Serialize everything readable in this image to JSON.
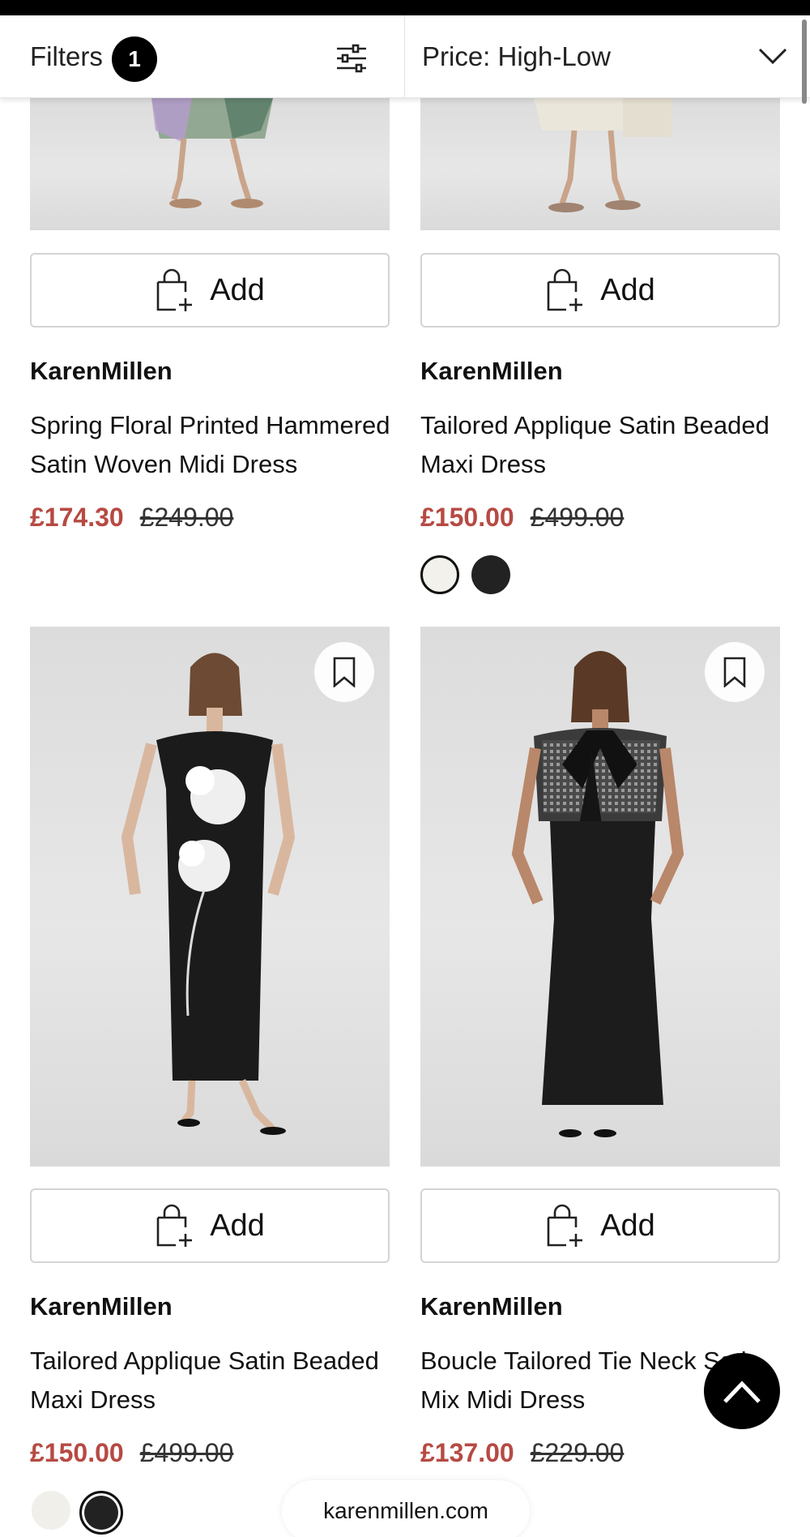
{
  "filter_bar": {
    "filters_label": "Filters",
    "filters_count": "1",
    "sort_label": "Price: High-Low"
  },
  "products": [
    {
      "add_label": "Add",
      "brand": "KarenMillen",
      "name": "Spring Floral Printed Hammered Satin Woven Midi Dress",
      "price_now": "£174.30",
      "price_was": "£249.00",
      "swatches": []
    },
    {
      "add_label": "Add",
      "brand": "KarenMillen",
      "name": "Tailored Applique Satin Beaded Maxi Dress",
      "price_now": "£150.00",
      "price_was": "£499.00",
      "swatches": [
        "#f2f1ec",
        "#222222"
      ]
    },
    {
      "add_label": "Add",
      "brand": "KarenMillen",
      "name": "Tailored Applique Satin Beaded Maxi Dress",
      "price_now": "£150.00",
      "price_was": "£499.00",
      "swatches": [
        "#f0efea",
        "#222222"
      ]
    },
    {
      "add_label": "Add",
      "brand": "KarenMillen",
      "name": "Boucle Tailored Tie Neck Satin Mix Midi Dress",
      "price_now": "£137.00",
      "price_was": "£229.00",
      "swatches": []
    }
  ],
  "footer": {
    "domain": "karenmillen.com"
  },
  "colors": {
    "sale_price": "#b64a43",
    "accent": "#000000"
  },
  "icons": [
    "sliders-icon",
    "chevron-down-icon",
    "bag-plus-icon",
    "bookmark-icon",
    "chevron-up-icon"
  ]
}
